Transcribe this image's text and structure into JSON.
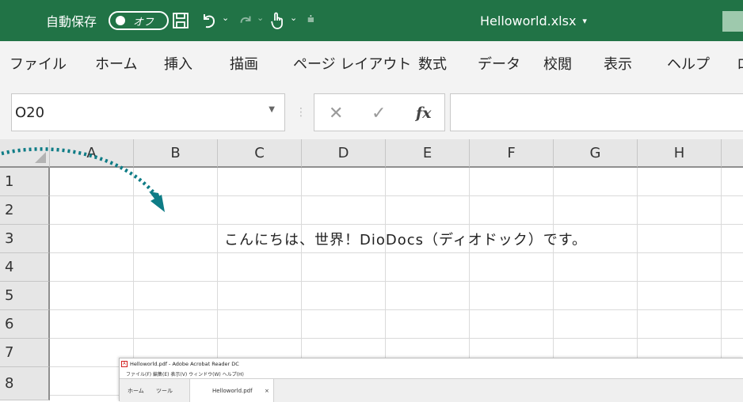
{
  "titlebar": {
    "autosave_label": "自動保存",
    "autosave_state": "オフ",
    "filename": "Helloworld.xlsx",
    "filename_caret": "▾",
    "icons": [
      "save-icon",
      "undo-icon",
      "redo-icon",
      "touch-mode-icon",
      "customize-qat-icon"
    ]
  },
  "ribbon": {
    "tabs": [
      "ファイル",
      "ホーム",
      "挿入",
      "描画",
      "ページ レイアウト",
      "数式",
      "データ",
      "校閲",
      "表示",
      "ヘルプ",
      "ロ"
    ]
  },
  "formula_bar": {
    "name_box": "O20",
    "fx": "fx",
    "content": ""
  },
  "grid": {
    "columns": [
      "A",
      "B",
      "C",
      "D",
      "E",
      "F",
      "G",
      "H"
    ],
    "rows": [
      "1",
      "2",
      "3",
      "4",
      "5",
      "6",
      "7",
      "8"
    ],
    "cell_c3": "こんにちは、世界！DioDocs（ディオドック）です。"
  },
  "pdf_viewer": {
    "title": "Helloworld.pdf - Adobe Acrobat Reader DC",
    "menu": "ファイル(F)  編集(E)  表示(V)  ウィンドウ(W)  ヘルプ(H)",
    "tab_home": "ホーム",
    "tab_tools": "ツール",
    "doc_tab": "Helloworld.pdf",
    "doc_tab_close": "×"
  },
  "colors": {
    "excel_green": "#217346",
    "arrow_teal": "#0e7c86"
  }
}
